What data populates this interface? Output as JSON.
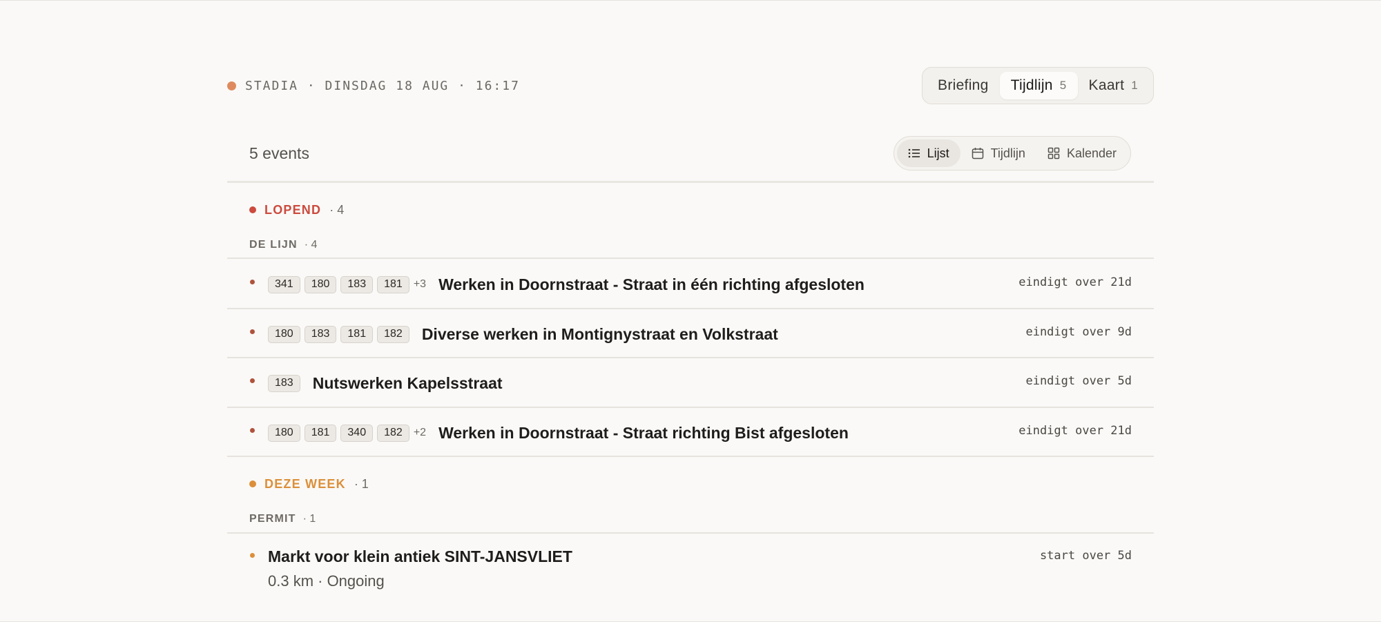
{
  "status": {
    "text": "STADIA · DINSDAG 18 AUG · 16:17",
    "color": "#df8a5e"
  },
  "view_tabs": [
    {
      "label": "Briefing",
      "count": ""
    },
    {
      "label": "Tijdlijn",
      "count": "5",
      "active": true
    },
    {
      "label": "Kaart",
      "count": "1"
    }
  ],
  "summary": {
    "event_count": "5 events"
  },
  "modes": [
    {
      "label": "Lijst",
      "icon": "list-icon",
      "active": true
    },
    {
      "label": "Tijdlijn",
      "icon": "calendar-icon"
    },
    {
      "label": "Kalender",
      "icon": "grid-icon"
    }
  ],
  "groups": {
    "lopend": {
      "label": "LOPEND",
      "count": "· 4",
      "color": "#cc4a3e",
      "source": {
        "label": "DE LIJN",
        "count": "· 4"
      },
      "events": [
        {
          "lines": [
            "341",
            "180",
            "183",
            "181"
          ],
          "more": "+3",
          "title": "Werken in Doornstraat - Straat in één richting afgesloten",
          "time": "eindigt over 21d"
        },
        {
          "lines": [
            "180",
            "183",
            "181",
            "182"
          ],
          "more": "",
          "title": "Diverse werken in Montignystraat en Volkstraat",
          "time": "eindigt over 9d"
        },
        {
          "lines": [
            "183"
          ],
          "more": "",
          "title": "Nutswerken Kapelsstraat",
          "time": "eindigt over 5d"
        },
        {
          "lines": [
            "180",
            "181",
            "340",
            "182"
          ],
          "more": "+2",
          "title": "Werken in Doornstraat - Straat richting Bist afgesloten",
          "time": "eindigt over 21d"
        }
      ],
      "dot_color": "#b0533c"
    },
    "deze_week": {
      "label": "DEZE WEEK",
      "count": "· 1",
      "color": "#dc8f3a",
      "source": {
        "label": "PERMIT",
        "count": "· 1"
      },
      "events": [
        {
          "title": "Markt voor klein antiek SINT-JANSVLIET",
          "subtitle": "0.3 km · Ongoing",
          "time": "start over 5d"
        }
      ]
    }
  }
}
